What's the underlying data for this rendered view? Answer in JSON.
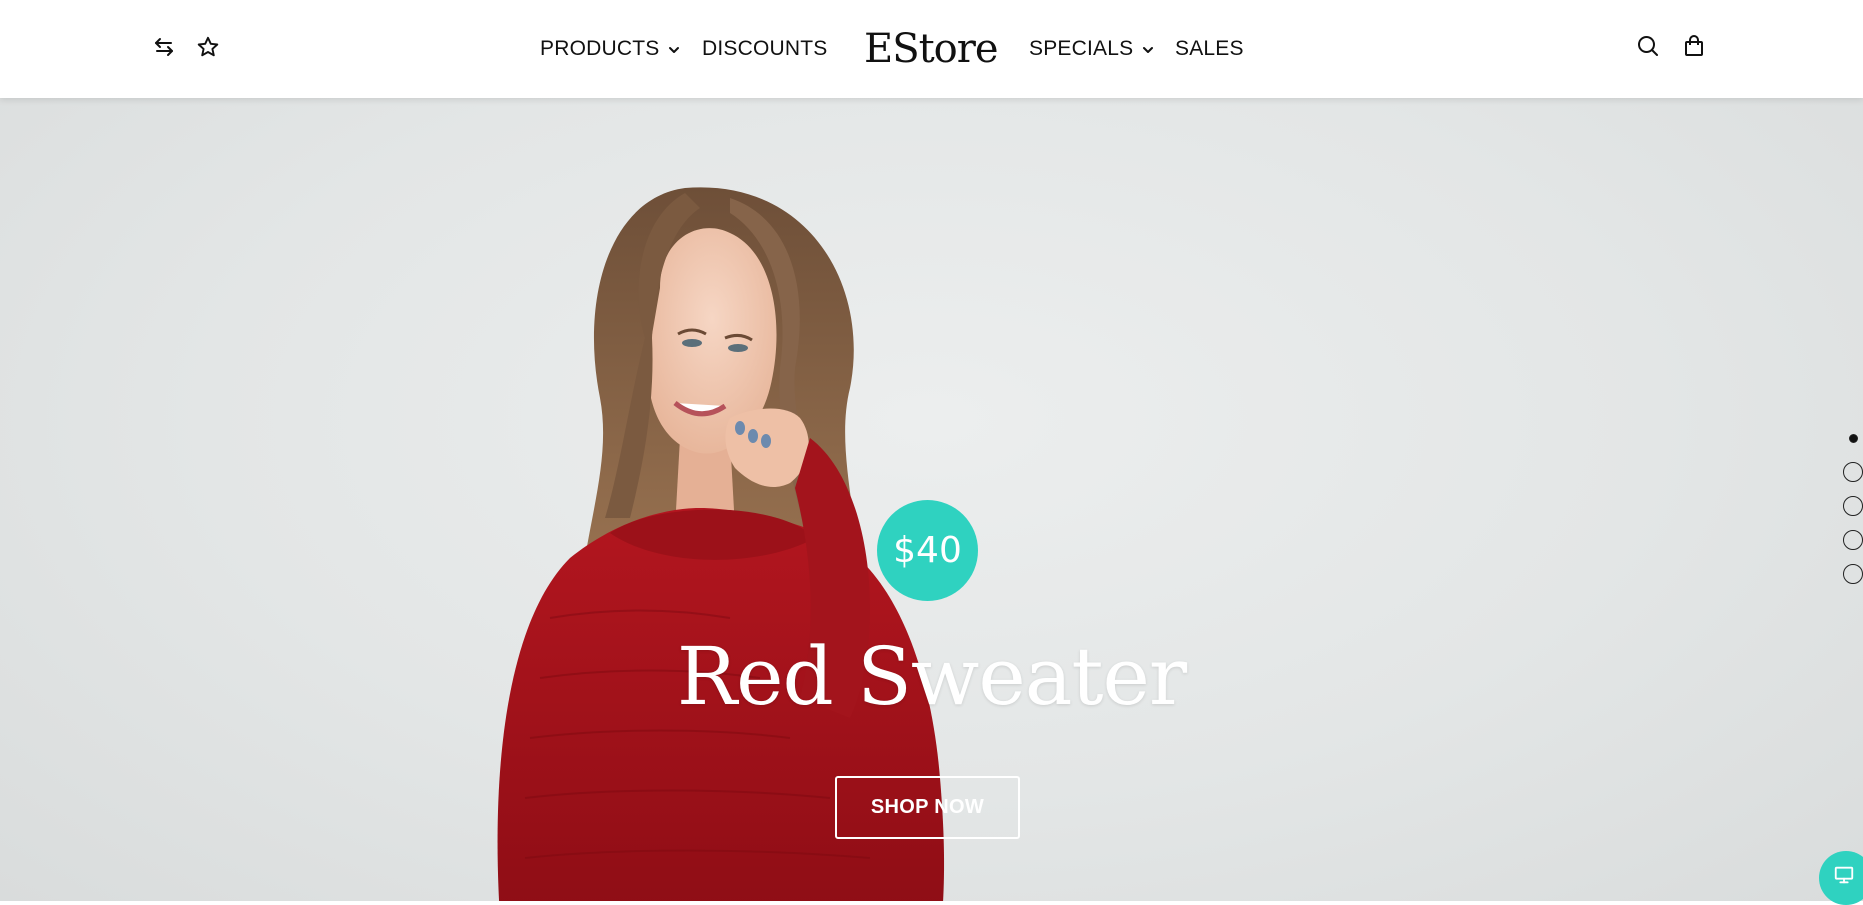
{
  "header": {
    "logo": "EStore",
    "nav": {
      "products": "PRODUCTS",
      "discounts": "DISCOUNTS",
      "specials": "SPECIALS",
      "sales": "SALES"
    },
    "icons": {
      "left": [
        "compare-arrows-icon",
        "star-icon"
      ],
      "right": [
        "search-icon",
        "shopping-bag-icon"
      ]
    }
  },
  "hero": {
    "price": "$40",
    "title": "Red Sweater",
    "button_label": "SHOP NOW",
    "slides_count": 5,
    "active_slide": 1,
    "accent_color": "#2fd2c0",
    "sweater_color": "#a8141c"
  },
  "floating_button_icon": "monitor-icon"
}
